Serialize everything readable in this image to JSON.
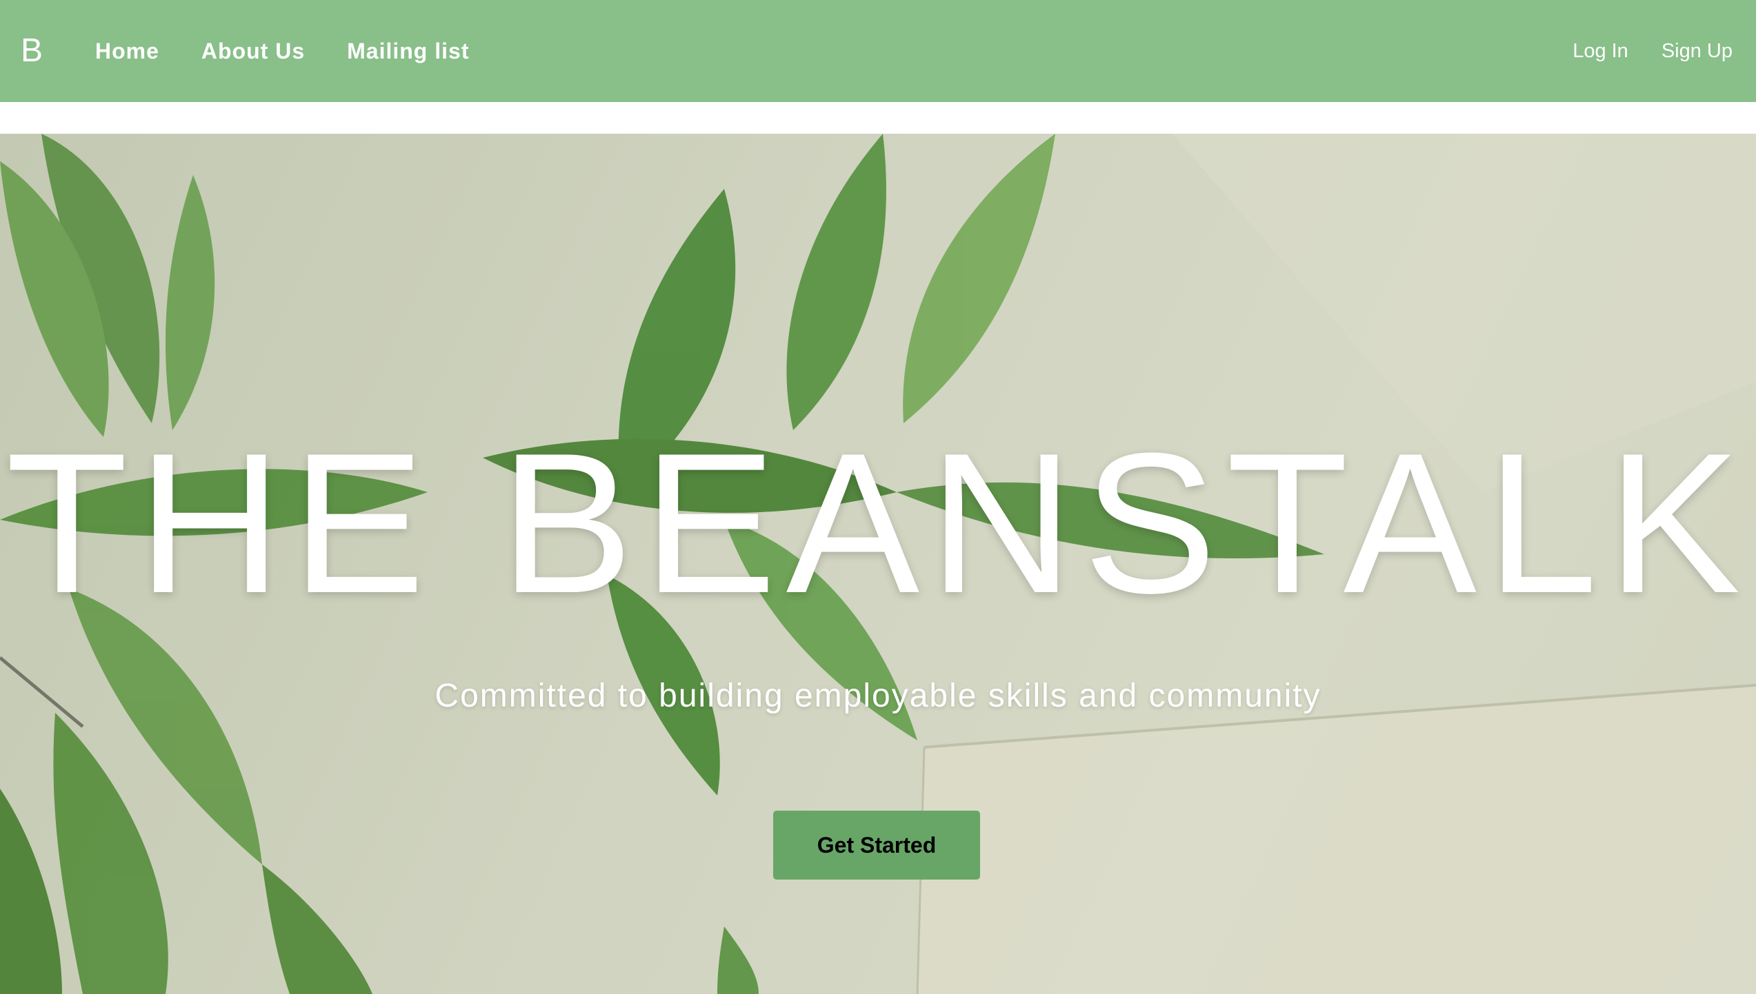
{
  "navbar": {
    "brand": "B",
    "links": [
      {
        "label": "Home"
      },
      {
        "label": "About Us"
      },
      {
        "label": "Mailing list"
      }
    ],
    "auth": {
      "login": "Log In",
      "signup": "Sign Up"
    },
    "background_color": "#89bf89"
  },
  "hero": {
    "title": "THE BEANSTALK",
    "subtitle": "Committed to building employable skills and community",
    "cta_label": "Get Started",
    "cta_color": "#67a667",
    "background_image": "green-plant-leaves-on-pale-wall"
  }
}
